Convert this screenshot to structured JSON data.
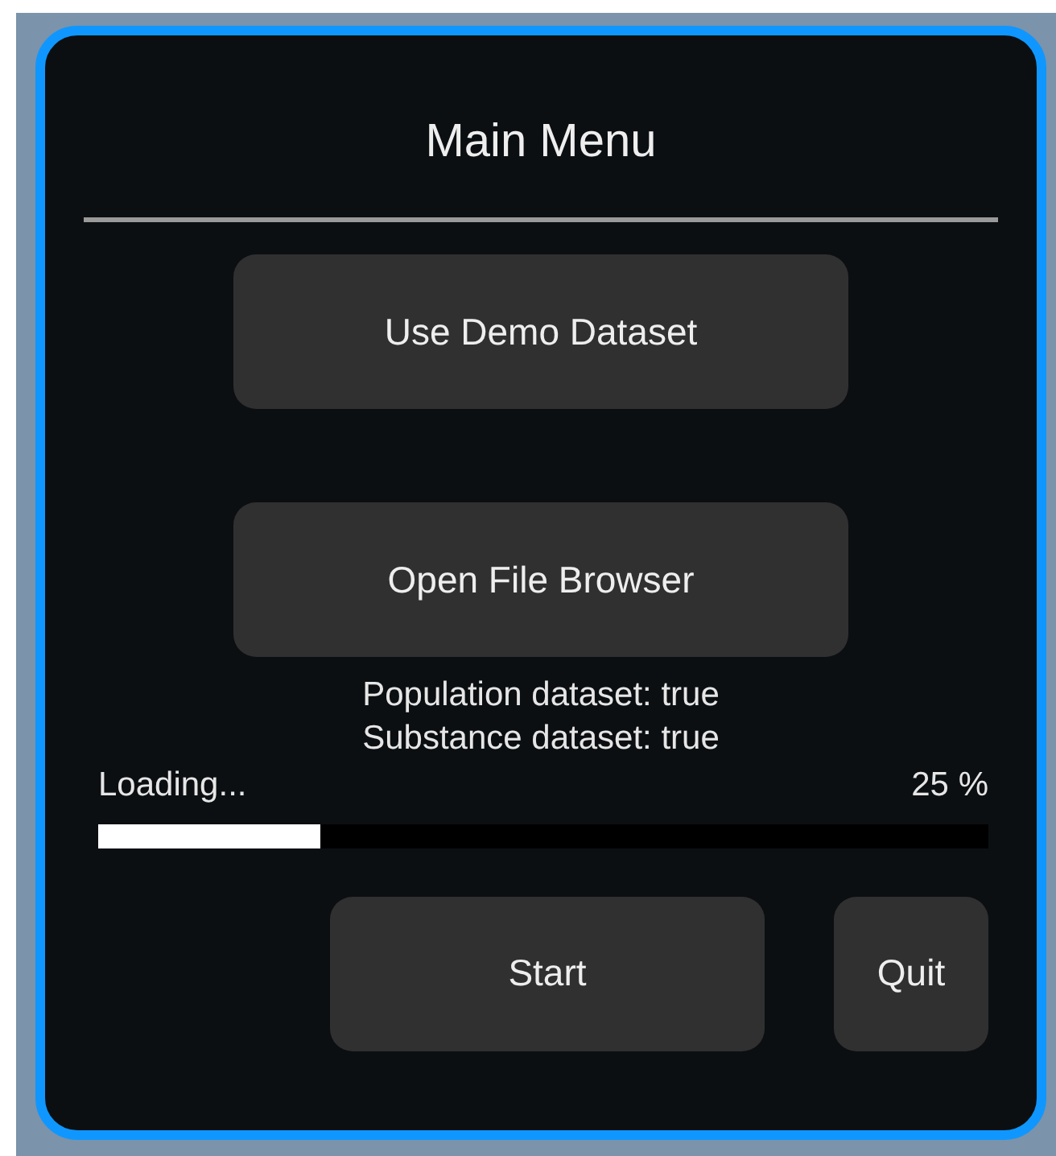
{
  "title": "Main Menu",
  "buttons": [
    {
      "label": "Use Demo Dataset"
    },
    {
      "label": "Open File Browser"
    }
  ],
  "status_lines": [
    "Population dataset: true",
    "Substance dataset: true"
  ],
  "progress": {
    "label": "Loading...",
    "reading": "25 %",
    "level": 0.25
  },
  "actions": [
    {
      "label": "Start"
    },
    {
      "label": "Quit"
    }
  ]
}
